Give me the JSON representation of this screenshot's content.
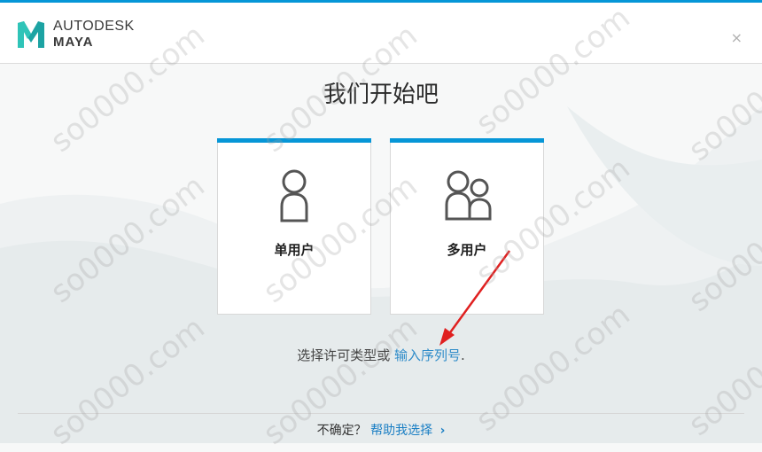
{
  "app": {
    "brand_line1": "AUTODESK",
    "brand_line2": "MAYA",
    "logo_letter": "M"
  },
  "header": {
    "close_label": "×"
  },
  "main": {
    "title": "我们开始吧",
    "cards": [
      {
        "label": "单用户",
        "icon": "single-user-icon"
      },
      {
        "label": "多用户",
        "icon": "multi-user-icon"
      }
    ],
    "choose_text": "选择许可类型或",
    "serial_link": "输入序列号",
    "choose_suffix": "."
  },
  "footer": {
    "question": "不确定？",
    "help_link": "帮助我选择",
    "chevron": "›"
  },
  "watermark_text": "so0000.com",
  "colors": {
    "accent": "#0696d7",
    "link": "#2d8bc9",
    "arrow": "#e02020"
  }
}
